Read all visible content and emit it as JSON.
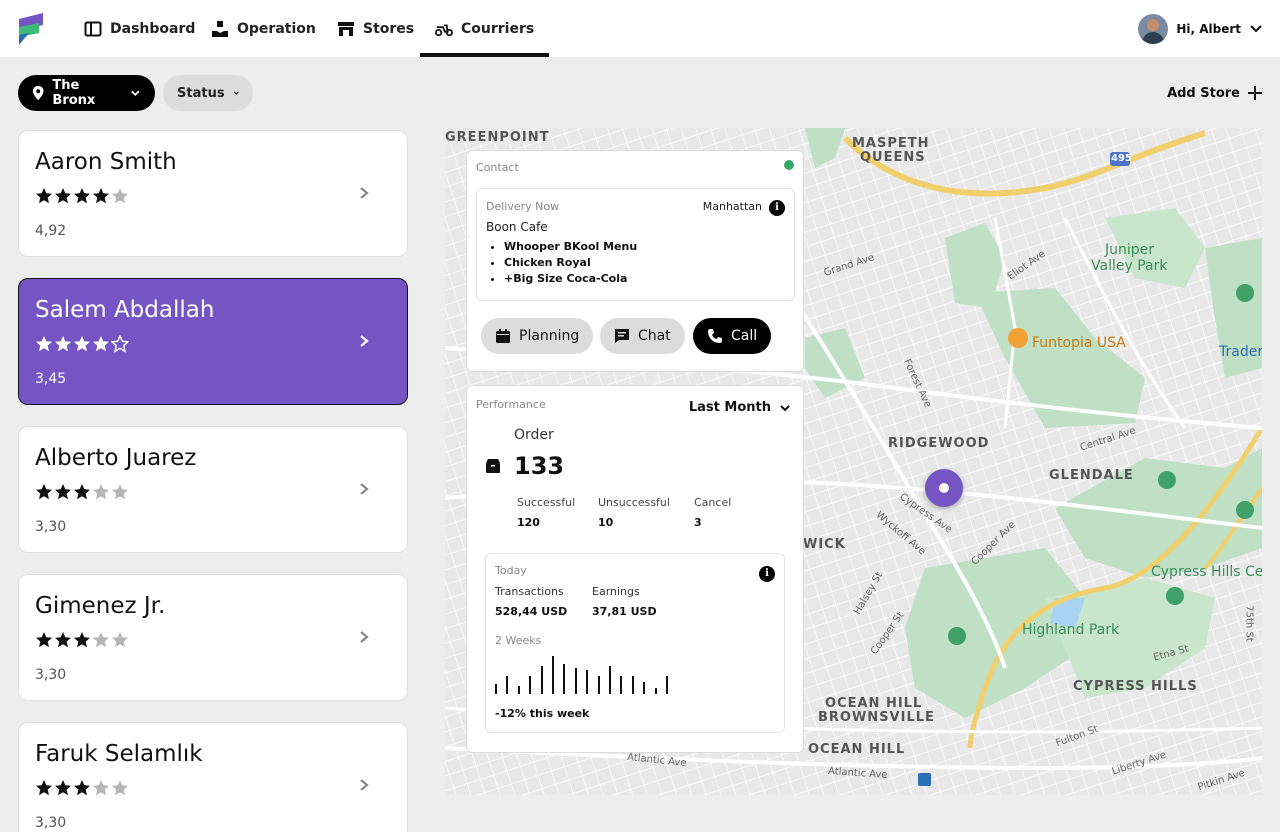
{
  "nav": {
    "items": [
      {
        "label": "Dashboard",
        "icon": "dashboard-icon"
      },
      {
        "label": "Operation",
        "icon": "operation-icon"
      },
      {
        "label": "Stores",
        "icon": "store-icon"
      },
      {
        "label": "Courriers",
        "icon": "scooter-icon"
      }
    ],
    "active": "Courriers",
    "user_greeting": "Hi, Albert"
  },
  "filters": {
    "location": "The Bronx",
    "status": "Status",
    "add_store": "Add Store"
  },
  "couriers": [
    {
      "name": "Aaron Smith",
      "rating": "4,92",
      "stars": 4,
      "selected": false
    },
    {
      "name": "Salem Abdallah",
      "rating": "3,45",
      "stars": 4,
      "selected": true
    },
    {
      "name": "Alberto Juarez",
      "rating": "3,30",
      "stars": 3,
      "selected": false
    },
    {
      "name": "Gimenez Jr.",
      "rating": "3,30",
      "stars": 3,
      "selected": false
    },
    {
      "name": "Faruk Selamlık",
      "rating": "3,30",
      "stars": 3,
      "selected": false
    }
  ],
  "contact": {
    "title": "Contact",
    "delivery_label": "Delivery Now",
    "location": "Manhattan",
    "store": "Boon Cafe",
    "items": [
      "Whooper BKool Menu",
      "Chicken Royal",
      "+Big Size Coca-Cola"
    ],
    "buttons": {
      "planning": "Planning",
      "chat": "Chat",
      "call": "Call"
    },
    "status_color": "#3aa367"
  },
  "performance": {
    "title": "Performance",
    "period": "Last Month",
    "order_label": "Order",
    "order_total": "133",
    "stats": [
      {
        "label": "Successful",
        "value": "120"
      },
      {
        "label": "Unsuccessful",
        "value": "10"
      },
      {
        "label": "Cancel",
        "value": "3"
      }
    ],
    "today_label": "Today",
    "transactions_label": "Transactions",
    "transactions_value": "528,44 USD",
    "earnings_label": "Earnings",
    "earnings_value": "37,81 USD",
    "weeks_label": "2 Weeks",
    "bar_values": [
      0.25,
      0.45,
      0.2,
      0.45,
      0.7,
      0.95,
      0.75,
      0.65,
      0.6,
      0.45,
      0.7,
      0.45,
      0.45,
      0.3,
      0.15,
      0.45
    ],
    "trend": "-12% this week"
  },
  "map": {
    "labels": {
      "greenpoint": "GREENPOINT",
      "maspeth": "MASPETH",
      "queens": "QUEENS",
      "ridgewood": "RIDGEWOOD",
      "glendale": "GLENDALE",
      "wick": "WICK",
      "ocean_hill_1": "OCEAN HILL",
      "brownsville": "BROWNSVILLE",
      "ocean_hill_2": "OCEAN HILL",
      "cypress_hills": "CYPRESS HILLS",
      "juniper_1": "Juniper",
      "juniper_2": "Valley Park",
      "funtopia": "Funtopia USA",
      "highland": "Highland Park",
      "cypress_hills_ce": "Cypress Hills Ce",
      "trader": "Trader",
      "grand_ave": "Grand Ave",
      "eliot_ave": "Eliot Ave",
      "forest_ave": "Forest Ave",
      "central_ave": "Central Ave",
      "cypress_ave": "Cypress Ave",
      "wyckoff_ave": "Wyckoff Ave",
      "cooper_ave": "Cooper Ave",
      "halsey_st": "Halsey St",
      "cooper_st": "Cooper St",
      "etna_st": "Etna St",
      "fulton_st": "Fulton St",
      "liberty_ave": "Liberty Ave",
      "pitkin_ave": "Pitkin Ave",
      "atlantic_ave_1": "Atlantic Ave",
      "atlantic_ave_2": "Atlantic Ave",
      "st_75": "75th St",
      "i495": "495"
    },
    "accent": "#7554c3"
  }
}
